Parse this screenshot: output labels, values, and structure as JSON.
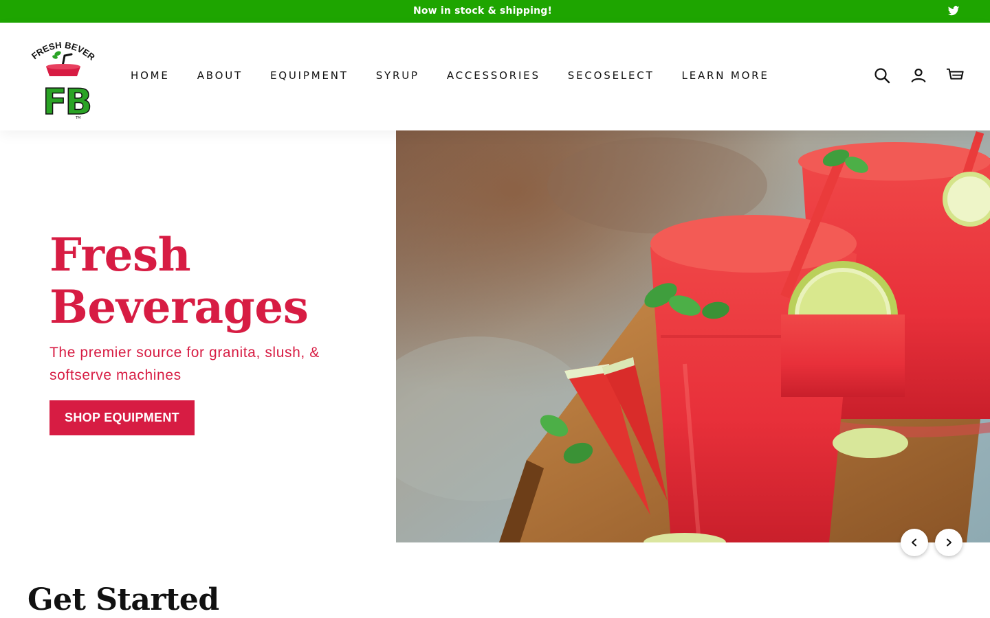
{
  "announcement": {
    "text": "Now in stock & shipping!",
    "social_icon": "twitter-icon"
  },
  "header": {
    "logo_text_top": "FRESH BEVERAGES",
    "logo_mark": "FB",
    "logo_tm": "TM",
    "nav": [
      {
        "label": "HOME"
      },
      {
        "label": "ABOUT"
      },
      {
        "label": "EQUIPMENT"
      },
      {
        "label": "SYRUP"
      },
      {
        "label": "ACCESSORIES"
      },
      {
        "label": "SECOSELECT"
      },
      {
        "label": "LEARN MORE"
      }
    ],
    "icons": [
      "search-icon",
      "account-icon",
      "cart-icon"
    ]
  },
  "hero": {
    "title_line1": "Fresh",
    "title_line2": "Beverages",
    "subtitle": "The premier source for granita, slush, & softserve machines",
    "button_label": "SHOP EQUIPMENT",
    "image": "watermelon-slush-drinks-image"
  },
  "section": {
    "title": "Get Started"
  },
  "colors": {
    "announcement_bg": "#1ea500",
    "brand_red": "#d71c43",
    "logo_green": "#2aa325"
  }
}
